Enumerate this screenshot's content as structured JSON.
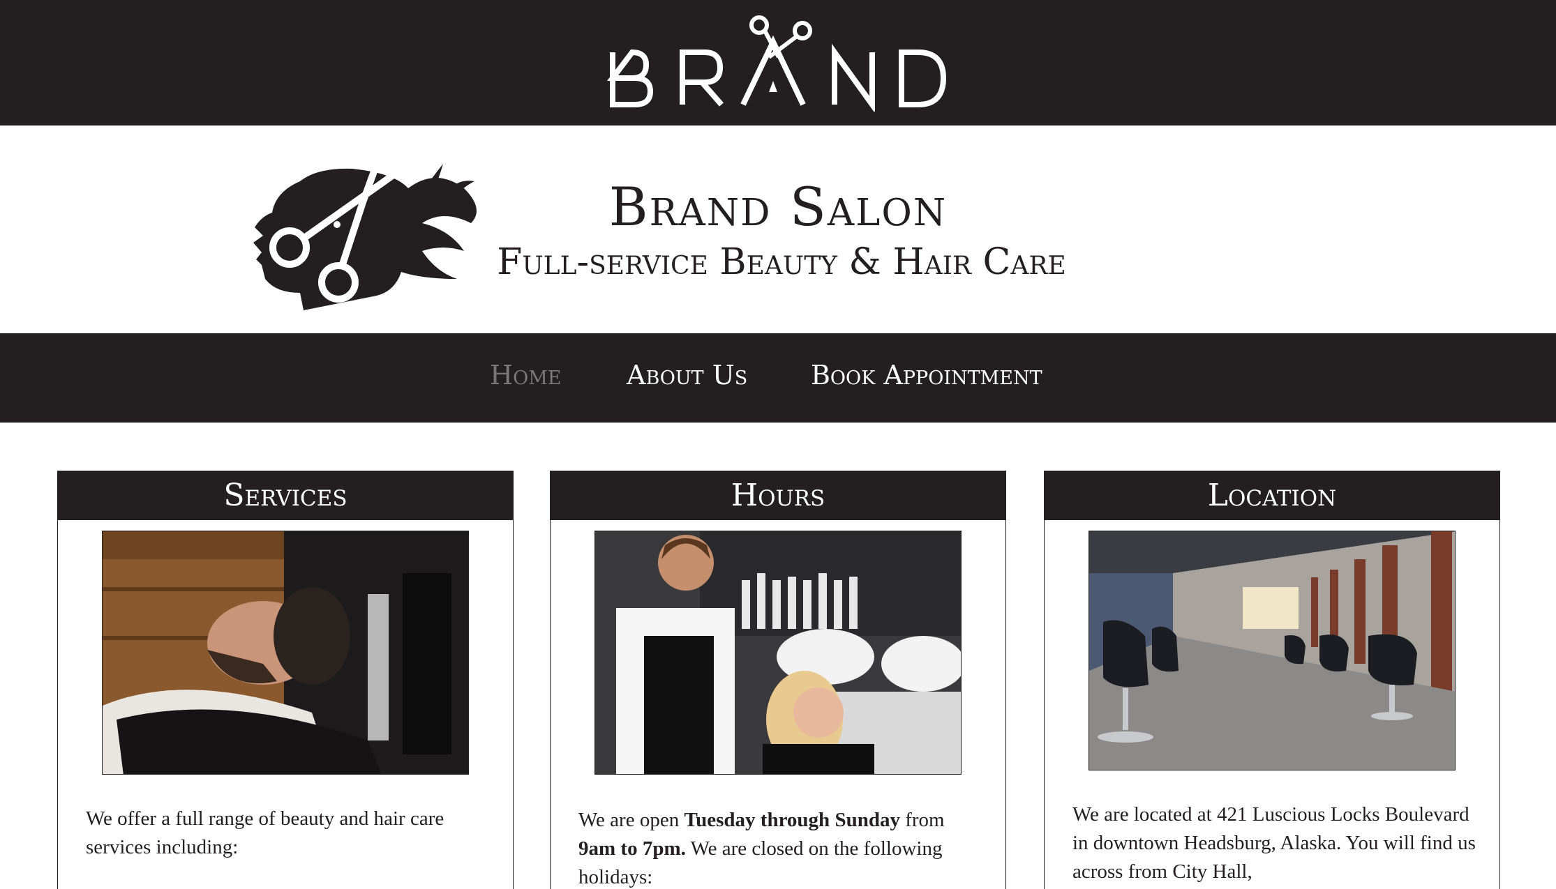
{
  "header": {
    "logo_text": "BRAND",
    "logo_icon": "scissors-icon"
  },
  "masthead": {
    "mark_icon": "woman-head-scissors-icon",
    "title": "Brand Salon",
    "tagline": "Full-service Beauty & Hair Care"
  },
  "nav": {
    "items": [
      {
        "label": "Home",
        "active": true
      },
      {
        "label": "About Us",
        "active": false
      },
      {
        "label": "Book Appointment",
        "active": false
      }
    ]
  },
  "cards": {
    "services": {
      "heading": "Services",
      "text": "We offer a full range of beauty and hair care services including:"
    },
    "hours": {
      "heading": "Hours",
      "text_1": "We are open ",
      "text_bold_1": "Tuesday through Sunday",
      "text_2": " from ",
      "text_bold_2": "9am to 7pm.",
      "text_3": " We are closed on the following holidays:"
    },
    "location": {
      "heading": "Location",
      "text_1": "We are located at 421 Luscious Locks Boulevard in downtown Headsburg, Alaska.",
      "text_2": " You will find us across from City Hall,"
    }
  },
  "colors": {
    "dark": "#231f20",
    "nav_active": "#7a7878",
    "white": "#ffffff"
  }
}
